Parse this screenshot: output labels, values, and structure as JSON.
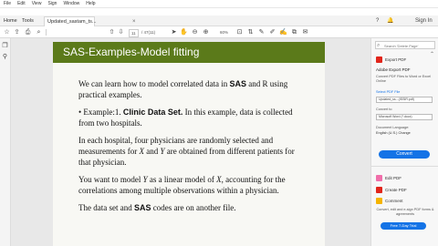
{
  "menubar": [
    "File",
    "Edit",
    "View",
    "Sign",
    "Window",
    "Help"
  ],
  "tabs": {
    "home": "Home",
    "tools": "Tools",
    "document": "Updated_sastam_ts..."
  },
  "tabrow_right": {
    "help": "?",
    "bell": "🔔",
    "signin": "Sign In"
  },
  "toolbar": {
    "page_current": "11",
    "page_total": "/ 47(11)",
    "zoom": "60%"
  },
  "slide": {
    "title": "SAS-Examples-Model fitting",
    "p1_a": "We can learn how to model correlated data in ",
    "p1_b": "SAS",
    "p1_c": " and R using practical examples.",
    "p2_a": "• Example:1. ",
    "p2_b": "Clinic Data Set.",
    "p2_c": " In this example, data is collected from two hospitals.",
    "p3_a": "In each hospital, four physicians are randomly selected and measurements for ",
    "p3_x": "X",
    "p3_and": " and ",
    "p3_y": "Y",
    "p3_c": " are obtained from different patients for that physician.",
    "p4_a": "You want to model ",
    "p4_y": "Y",
    "p4_b": " as a linear model of ",
    "p4_x": "X",
    "p4_c": ", accounting for the correlations among multiple observations within a physician.",
    "p5_a": "The data set and ",
    "p5_b": "SAS",
    "p5_c": " codes are on another file."
  },
  "rightpanel": {
    "search_placeholder": "Search 'Delete Page'",
    "export_pdf": "Export PDF",
    "adobe_export": "Adobe Export PDF",
    "convert_desc": "Convert PDF Files to Word or Excel Online",
    "select_file": "Select PDF File",
    "file_name": "Updated_ss...(ISSIR.pdf)",
    "convert_to_label": "Convert to",
    "convert_to_value": "Microsoft Word (*.docx)",
    "language_label": "Document Language:",
    "language_value": "English (U.S.) Change",
    "convert_button": "Convert",
    "edit_pdf": "Edit PDF",
    "create_pdf": "Create PDF",
    "comment": "Comment",
    "promo": "Convert, edit and e-sign PDF forms & agreements",
    "trial_button": "Free 7-Day Trial"
  },
  "colors": {
    "title_bar": "#5b7a1a",
    "accent_blue": "#1473e6",
    "export_red": "#e1251b"
  }
}
